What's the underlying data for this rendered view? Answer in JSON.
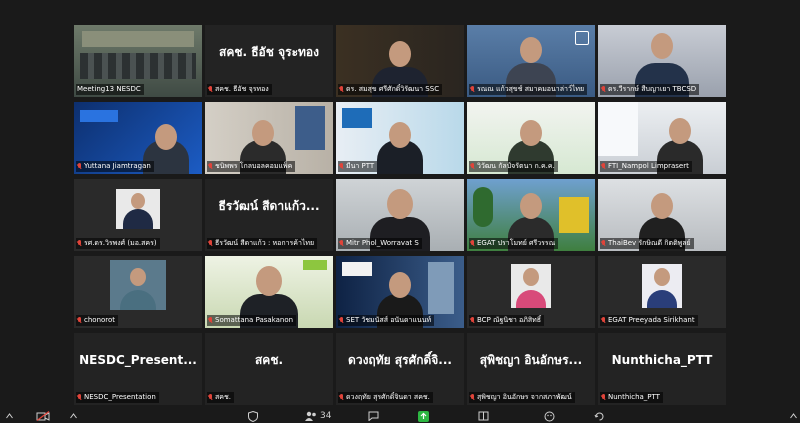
{
  "tiles": [
    {
      "label": "Meeting13 NESDC",
      "muted": false
    },
    {
      "big": "สคช. ธีอัช จุระทอง",
      "label": "สคช. ธีอัช จุรทอง",
      "muted": true
    },
    {
      "label": "ดร. สมสุข ศรีศักดิ์วิรัฒนา SSC",
      "muted": true
    },
    {
      "label": "รณณ แก้วสุขช์ สมาคมอนาล่าว์ไทย",
      "muted": true
    },
    {
      "label": "ดร.วีรากษ์ สืบญาเยา TBCSD",
      "muted": true
    },
    {
      "label": "Yuttana Jiamtragan",
      "muted": true
    },
    {
      "label": "ชนิพพร โกลบอลคอมแพ็ค",
      "muted": true
    },
    {
      "label": "มีนา PTT",
      "muted": true
    },
    {
      "label": "วิวัฒน กัลป์จรัตนา ก.ค.ค.",
      "muted": true
    },
    {
      "label": "FTI_Nampol Limprasert",
      "muted": true
    },
    {
      "label": "รศ.ดร.วิรพงศ์ (มอ.สคร)",
      "muted": true
    },
    {
      "big": "ธีรวัฒน์ สีดาแก้ว...",
      "label": "ธีรวัฒน์ สีดาแก้ว : หอการค้าไทย",
      "muted": true
    },
    {
      "label": "Mitr Phol_Worravat S",
      "muted": true
    },
    {
      "label": "EGAT ปราโมทย์ ศรีวรรณ",
      "muted": true
    },
    {
      "label": "ThaiBev รักษิณดี กิตติพูลย์",
      "muted": true
    },
    {
      "label": "chonorot",
      "muted": true
    },
    {
      "label": "Somattana Pasakanon",
      "muted": true
    },
    {
      "label": "SET วัชมนัสส์ อนันดาแนนท์",
      "muted": true
    },
    {
      "label": "BCP ณัฐนิชา อภิสิทธิ์",
      "muted": true
    },
    {
      "label": "EGAT Preeyada Sirikhant",
      "muted": true
    },
    {
      "big": "NESDC_Present...",
      "label": "NESDC_Presentation",
      "muted": true
    },
    {
      "big": "สคช.",
      "label": "สคช.",
      "muted": true
    },
    {
      "big": "ดวงฤทัย สุรศักดิ์จิ...",
      "label": "ดวงฤทัย สุรศักดิ์จินดา สคช.",
      "muted": true
    },
    {
      "big": "สุพิชญา อินอักษร...",
      "label": "สุพิชญา อินอักษร จากสภาพัฒน์",
      "muted": true
    },
    {
      "big": "Nunthicha_PTT",
      "label": "Nunthicha_PTT",
      "muted": true
    }
  ],
  "toolbar": {
    "participants_count": "34"
  },
  "colors": {
    "active_speaker": "#e6e62e",
    "muted": "#e0443a",
    "share": "#2db742"
  }
}
